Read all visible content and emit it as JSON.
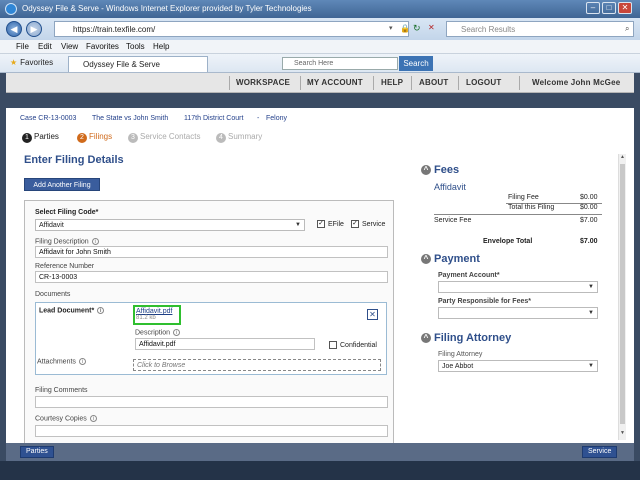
{
  "window": {
    "title": "Odyssey File & Serve - Windows Internet Explorer provided by Tyler Technologies",
    "url": "https://train.texfile.com/",
    "search_placeholder": "Search Results"
  },
  "menu": [
    "File",
    "Edit",
    "View",
    "Favorites",
    "Tools",
    "Help"
  ],
  "favorites": {
    "label": "Favorites",
    "tab": "Odyssey File & Serve"
  },
  "site_search": {
    "placeholder": "Search Here",
    "button": "Search"
  },
  "nav": [
    "WORKSPACE",
    "MY ACCOUNT",
    "HELP",
    "ABOUT",
    "LOGOUT"
  ],
  "welcome": "Welcome John McGee",
  "case": {
    "number": "Case CR-13-0003",
    "title": "The State vs John Smith",
    "court": "117th District Court",
    "dash": "-",
    "type": "Felony"
  },
  "steps": [
    {
      "num": "1",
      "label": "Parties",
      "state": "done"
    },
    {
      "num": "2",
      "label": "Filings",
      "state": "active"
    },
    {
      "num": "3",
      "label": "Service Contacts",
      "state": "pending"
    },
    {
      "num": "4",
      "label": "Summary",
      "state": "pending"
    }
  ],
  "page_title": "Enter Filing Details",
  "add_filing": "Add Another Filing",
  "form": {
    "filing_code_label": "Select Filing Code*",
    "filing_code": "Affidavit",
    "efile": "EFile",
    "service": "Service",
    "description_label": "Filing Description",
    "description": "Affidavit for John Smith",
    "reference_label": "Reference Number",
    "reference": "CR-13-0003",
    "documents_label": "Documents",
    "lead_document_label": "Lead Document*",
    "file_name": "Affidavit.pdf",
    "file_size": "81.2 kb",
    "doc_description_label": "Description",
    "doc_description": "Affidavit.pdf",
    "confidential": "Confidential",
    "attachments_label": "Attachments",
    "browse_placeholder": "Click to Browse",
    "comments_label": "Filing Comments",
    "courtesy_label": "Courtesy Copies"
  },
  "fees": {
    "heading": "Fees",
    "item": "Affidavit",
    "filing_fee_label": "Filing Fee",
    "filing_fee": "$0.00",
    "total_filing_label": "Total this Filing",
    "total_filing": "$0.00",
    "service_fee_label": "Service Fee",
    "service_fee": "$7.00",
    "envelope_total_label": "Envelope Total",
    "envelope_total": "$7.00"
  },
  "payment": {
    "heading": "Payment",
    "account_label": "Payment Account*",
    "party_label": "Party Responsible for Fees*"
  },
  "attorney": {
    "heading": "Filing Attorney",
    "label": "Filing Attorney",
    "value": "Joe Abbot"
  },
  "bottom": {
    "back": "Parties",
    "next": "Service"
  }
}
